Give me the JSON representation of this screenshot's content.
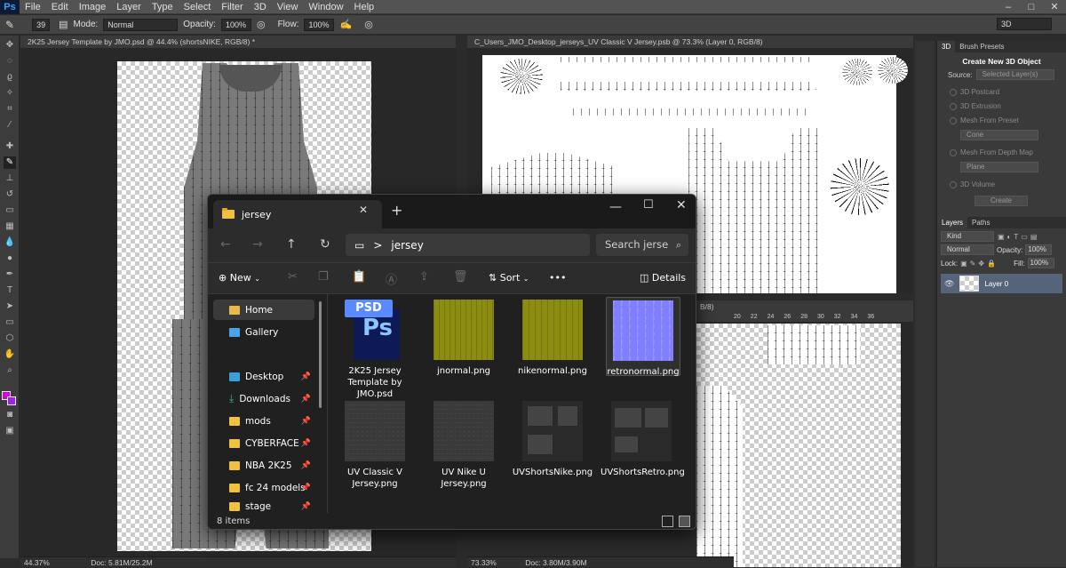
{
  "ps": {
    "logo": "Ps",
    "menu": [
      "File",
      "Edit",
      "Image",
      "Layer",
      "Type",
      "Select",
      "Filter",
      "3D",
      "View",
      "Window",
      "Help"
    ],
    "window_controls": [
      "–",
      "□",
      "✕"
    ],
    "options": {
      "brush_size": "39",
      "mode_label": "Mode:",
      "mode_value": "Normal",
      "opacity_label": "Opacity:",
      "opacity_value": "100%",
      "flow_label": "Flow:",
      "flow_value": "100%",
      "workspace": "3D"
    },
    "doc1": {
      "tab": "2K25 Jersey Template by JMO.psd @ 44.4% (shortsNIKE, RGB/8) *",
      "zoom": "44.37%",
      "doc_size": "Doc: 5.81M/25.2M"
    },
    "doc2": {
      "tab": "C_Users_JMO_Desktop_jerseys_UV Classic V Jersey.psb @ 73.3% (Layer 0, RGB/8)",
      "zoom": "73.33%",
      "doc_size": "Doc: 3.80M/3.90M"
    },
    "doc3": {
      "tab": "B/8)",
      "ruler": [
        "20",
        "22",
        "24",
        "26",
        "28",
        "30",
        "32",
        "34",
        "36"
      ]
    },
    "panel3d": {
      "tabs": [
        "3D",
        "Brush Presets"
      ],
      "title": "Create New 3D Object",
      "source_label": "Source:",
      "source_value": "Selected Layer(s)",
      "options": [
        "3D Postcard",
        "3D Extrusion",
        "Mesh From Preset",
        "Mesh From Depth Map",
        "3D Volume"
      ],
      "preset_value": "Cone",
      "depth_value": "Plane",
      "create_label": "Create"
    },
    "layers": {
      "tabs": [
        "Layers",
        "Paths"
      ],
      "kind": "Kind",
      "blend": "Normal",
      "opacity_label": "Opacity:",
      "opacity_value": "100%",
      "lock_label": "Lock:",
      "fill_label": "Fill:",
      "fill_value": "100%",
      "layer_name": "Layer 0"
    }
  },
  "explorer": {
    "tab_title": "jersey",
    "address": "jersey",
    "address_sep": ">",
    "search_placeholder": "Search jerse",
    "new_label": "New",
    "sort_label": "Sort",
    "details_label": "Details",
    "more_label": "•••",
    "sidebar": [
      {
        "label": "Home",
        "pinned": false,
        "color": "#e8b84a"
      },
      {
        "label": "Gallery",
        "pinned": false,
        "color": "#4aa3e8"
      },
      {
        "label": "Desktop",
        "pinned": true,
        "color": "#3aa0d8"
      },
      {
        "label": "Downloads",
        "pinned": true,
        "color": "#3ab87a"
      },
      {
        "label": "mods",
        "pinned": true,
        "color": "#f0c040"
      },
      {
        "label": "CYBERFACE",
        "pinned": true,
        "color": "#f0c040"
      },
      {
        "label": "NBA 2K25",
        "pinned": true,
        "color": "#f0c040"
      },
      {
        "label": "fc 24 models",
        "pinned": true,
        "color": "#f0c040"
      },
      {
        "label": "stage",
        "pinned": true,
        "color": "#f0c040"
      }
    ],
    "files": [
      {
        "name": "2K25 Jersey Template by JMO.psd",
        "thumb": "psd",
        "badge": "PSD",
        "logo": "Ps"
      },
      {
        "name": "jnormal.png",
        "thumb": "olive"
      },
      {
        "name": "nikenormal.png",
        "thumb": "olive"
      },
      {
        "name": "retronormal.png",
        "thumb": "blue",
        "selected": true
      },
      {
        "name": "UV Classic V Jersey.png",
        "thumb": "dark"
      },
      {
        "name": "UV Nike U Jersey.png",
        "thumb": "dark"
      },
      {
        "name": "UVShortsNike.png",
        "thumb": "dark2"
      },
      {
        "name": "UVShortsRetro.png",
        "thumb": "dark2"
      }
    ],
    "status": "8 items"
  }
}
